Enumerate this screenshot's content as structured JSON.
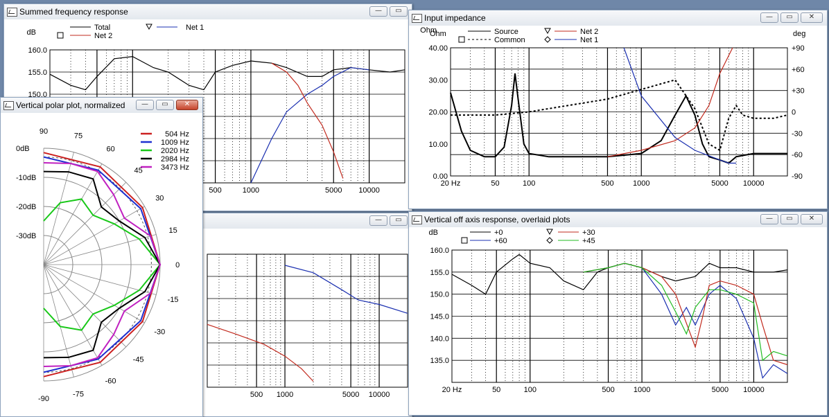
{
  "windows": {
    "summed": {
      "title": "Summed frequency response"
    },
    "middle": {
      "title": ""
    },
    "impedance": {
      "title": "Input impedance"
    },
    "offaxis": {
      "title": "Vertical off axis response, overlaid plots"
    },
    "polar": {
      "title": "Vertical polar plot, normalized"
    }
  },
  "buttons": {
    "minimize": "—",
    "maximize": "▭",
    "close": "✕"
  },
  "icons": {
    "window": "graph-icon",
    "minimize": "minimize-icon",
    "maximize": "maximize-icon",
    "close": "close-icon"
  },
  "chart_data": [
    {
      "id": "summed",
      "type": "line",
      "xscale": "log",
      "xlim": [
        20,
        20000
      ],
      "ylim": [
        130,
        160
      ],
      "ylabel": "dB",
      "y_ticks": [
        "160.0",
        "155.0",
        "150.0"
      ],
      "x_ticks": [
        "500",
        "1000",
        "5000",
        "10000"
      ],
      "legend": [
        "Total",
        "Net 1",
        "Net 2"
      ],
      "series": [
        {
          "name": "Total",
          "color": "#000000",
          "x": [
            20,
            30,
            40,
            50,
            70,
            100,
            150,
            200,
            300,
            400,
            500,
            700,
            1000,
            1500,
            2000,
            3000,
            4000,
            5000,
            7000,
            10000,
            15000,
            20000
          ],
          "y": [
            154.5,
            152,
            151,
            154,
            158,
            158.5,
            156,
            155,
            152,
            151,
            155,
            156.5,
            157.5,
            157,
            156,
            154,
            154,
            155.5,
            156,
            155.5,
            155,
            155.5
          ]
        },
        {
          "name": "Net 1",
          "color": "#1a2fb0",
          "x": [
            1000,
            1500,
            2000,
            3000,
            4000,
            5000,
            7000,
            10000
          ],
          "y": [
            130,
            140,
            146,
            150,
            152,
            154,
            156,
            155.5
          ]
        },
        {
          "name": "Net 2",
          "color": "#c22a1e",
          "x": [
            1500,
            2000,
            2500,
            3000,
            4000,
            5000,
            6000
          ],
          "y": [
            157,
            155,
            152,
            148,
            143,
            137,
            131
          ]
        }
      ]
    },
    {
      "id": "middle",
      "type": "line",
      "xscale": "log",
      "xlim": [
        150,
        20000
      ],
      "ylim": [
        0,
        180
      ],
      "x_ticks": [
        "500",
        "1000",
        "5000",
        "10000"
      ],
      "series": [
        {
          "name": "",
          "color": "#1a2fb0",
          "x": [
            1000,
            2000,
            4000,
            6000,
            10000,
            20000
          ],
          "y": [
            165,
            155,
            132,
            118,
            112,
            100
          ]
        },
        {
          "name": "",
          "color": "#c22a1e",
          "x": [
            150,
            300,
            600,
            1000,
            1500,
            2000
          ],
          "y": [
            85,
            72,
            58,
            42,
            25,
            8
          ]
        }
      ]
    },
    {
      "id": "impedance",
      "type": "line",
      "xscale": "log",
      "xlim": [
        20,
        20000
      ],
      "ylim": [
        0,
        40
      ],
      "ylabel": "Ohm",
      "y2label": "deg",
      "y_ticks": [
        "40.00",
        "30.00",
        "20.00",
        "10.00",
        "0.00"
      ],
      "y2_ticks": [
        "+90",
        "+60",
        "+30",
        "0",
        "-30",
        "-60",
        "-90"
      ],
      "x_ticks": [
        "20 Hz",
        "50",
        "100",
        "500",
        "1000",
        "5000",
        "10000"
      ],
      "legend": [
        "Source",
        "Common",
        "Net 2",
        "Net 1"
      ],
      "series": [
        {
          "name": "Source",
          "color": "#000000",
          "x": [
            20,
            25,
            30,
            40,
            50,
            60,
            70,
            75,
            80,
            90,
            100,
            150,
            200,
            500,
            1000,
            1500,
            2000,
            2500,
            3000,
            3500,
            4000,
            5000,
            6000,
            7000,
            10000,
            15000,
            20000
          ],
          "y": [
            26,
            14,
            8,
            6,
            6,
            9,
            22,
            32,
            24,
            10,
            7,
            6,
            6,
            6,
            7,
            11,
            19,
            25,
            19,
            10,
            6,
            5,
            4,
            6,
            7,
            7,
            7
          ]
        },
        {
          "name": "Common",
          "color": "#000000",
          "x": [
            20,
            50,
            100,
            500,
            1000,
            2000,
            3000,
            4000,
            5000,
            6000,
            7000,
            8000,
            10000,
            15000,
            20000
          ],
          "y": [
            19,
            19,
            20,
            24,
            27,
            30,
            21,
            10,
            8,
            18,
            22,
            19,
            18,
            18,
            19
          ]
        },
        {
          "name": "Net 2",
          "color": "#c22a1e",
          "x": [
            500,
            1000,
            2000,
            3000,
            4000,
            5000,
            6500
          ],
          "y": [
            6,
            8,
            11,
            15,
            22,
            32,
            40
          ]
        },
        {
          "name": "Net 1",
          "color": "#1a2fb0",
          "x": [
            700,
            1000,
            2000,
            3000,
            5000,
            6000,
            7000
          ],
          "y": [
            40,
            25,
            12,
            8,
            5,
            4,
            4
          ]
        }
      ]
    },
    {
      "id": "offaxis",
      "type": "line",
      "xscale": "log",
      "xlim": [
        20,
        20000
      ],
      "ylim": [
        130,
        160
      ],
      "ylabel": "dB",
      "y_ticks": [
        "160.0",
        "155.0",
        "150.0",
        "145.0",
        "140.0",
        "135.0"
      ],
      "x_ticks": [
        "20 Hz",
        "50",
        "100",
        "500",
        "1000",
        "5000",
        "10000"
      ],
      "legend": [
        "+0",
        "+60",
        "+30",
        "+45"
      ],
      "series": [
        {
          "name": "+0",
          "color": "#000000",
          "x": [
            20,
            30,
            40,
            50,
            70,
            80,
            100,
            150,
            200,
            300,
            400,
            500,
            700,
            1000,
            1500,
            2000,
            3000,
            4000,
            5000,
            7000,
            10000,
            15000,
            20000
          ],
          "y": [
            154.5,
            152,
            150,
            155,
            158,
            159,
            157,
            156,
            153,
            151,
            155,
            156,
            157,
            156,
            154,
            153,
            154,
            157,
            156,
            156,
            155,
            155,
            155.5
          ]
        },
        {
          "name": "+60",
          "color": "#1a2fb0",
          "x": [
            300,
            500,
            700,
            1000,
            1500,
            2000,
            2500,
            3000,
            4000,
            5000,
            7000,
            10000,
            12000,
            15000,
            20000
          ],
          "y": [
            155,
            156,
            157,
            156,
            150,
            143,
            147,
            143,
            150,
            152,
            149,
            140,
            131,
            134,
            132
          ]
        },
        {
          "name": "+30",
          "color": "#c22a1e",
          "x": [
            300,
            500,
            700,
            1000,
            1500,
            2000,
            3000,
            3500,
            4000,
            5000,
            7000,
            10000,
            12000,
            15000,
            20000
          ],
          "y": [
            155,
            156,
            157,
            156,
            154,
            150,
            138,
            145,
            152,
            153,
            152,
            150,
            143,
            135,
            134
          ]
        },
        {
          "name": "+45",
          "color": "#22bb22",
          "x": [
            300,
            500,
            700,
            1000,
            1500,
            2000,
            2500,
            3000,
            4000,
            5000,
            7000,
            10000,
            12000,
            15000,
            20000
          ],
          "y": [
            155,
            156,
            157,
            156,
            152,
            146,
            141,
            147,
            151,
            151,
            150,
            148,
            135,
            137,
            136
          ]
        }
      ]
    },
    {
      "id": "polar",
      "type": "polar",
      "r_labels": [
        "0dB",
        "-10dB",
        "-20dB",
        "-30dB"
      ],
      "angle_labels": [
        "90",
        "75",
        "60",
        "45",
        "30",
        "15",
        "0",
        "-15",
        "-30",
        "-45",
        "-60",
        "-75",
        "-90"
      ],
      "legend": [
        "504 Hz",
        "1009 Hz",
        "2020 Hz",
        "2984 Hz",
        "3473 Hz"
      ],
      "series": [
        {
          "name": "504 Hz",
          "color": "#cc2020",
          "angles": [
            90,
            60,
            30,
            0,
            -30,
            -60,
            -90
          ],
          "db": [
            -1.5,
            -1.2,
            -0.8,
            0,
            -0.8,
            -1.2,
            -1.5
          ]
        },
        {
          "name": "1009 Hz",
          "color": "#1e2fd0",
          "angles": [
            90,
            60,
            30,
            0,
            -30,
            -60,
            -90
          ],
          "db": [
            -3,
            -2.5,
            -1.5,
            0,
            -1.5,
            -2.5,
            -3
          ]
        },
        {
          "name": "2020 Hz",
          "color": "#18c818",
          "angles": [
            90,
            75,
            60,
            45,
            30,
            15,
            0,
            -15,
            -30,
            -45,
            -60,
            -75,
            -90
          ],
          "db": [
            -25,
            -18,
            -14,
            -16,
            -12,
            -6,
            0,
            -6,
            -12,
            -16,
            -14,
            -18,
            -25
          ]
        },
        {
          "name": "2984 Hz",
          "color": "#000000",
          "angles": [
            90,
            75,
            60,
            45,
            30,
            15,
            0,
            -15,
            -30,
            -45,
            -60,
            -75,
            -90
          ],
          "db": [
            -8,
            -7,
            -6,
            -12,
            -10,
            -4,
            0,
            -4,
            -10,
            -12,
            -6,
            -7,
            -8
          ]
        },
        {
          "name": "3473 Hz",
          "color": "#c020c0",
          "angles": [
            90,
            75,
            60,
            45,
            30,
            15,
            0,
            -15,
            -30,
            -45,
            -60,
            -75,
            -90
          ],
          "db": [
            -5,
            -4,
            -3,
            -6,
            -8,
            -2,
            0,
            -2,
            -8,
            -6,
            -3,
            -4,
            -5
          ]
        }
      ]
    }
  ]
}
